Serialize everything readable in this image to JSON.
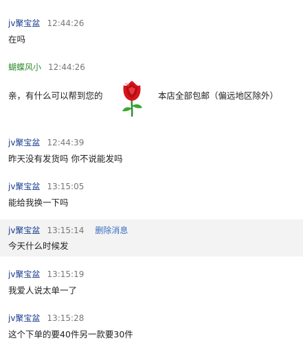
{
  "messages": [
    {
      "sender": "jv聚宝盆",
      "time": "12:44:26",
      "text": "在吗"
    },
    {
      "sender": "蝴蝶风小",
      "time": "12:44:26",
      "text_a": "亲，有什么可以帮到您的",
      "emoji": "rose-emoji",
      "text_b": "本店全部包邮（偏远地区除外）"
    },
    {
      "sender": "jv聚宝盆",
      "time": "12:44:39",
      "text": "昨天没有发货吗 你不说能发吗"
    },
    {
      "sender": "jv聚宝盆",
      "time": "13:15:05",
      "text": "能给我换一下吗"
    },
    {
      "sender": "jv聚宝盆",
      "time": "13:15:14",
      "action": "删除消息",
      "text": "今天什么时候发"
    },
    {
      "sender": "jv聚宝盆",
      "time": "13:15:19",
      "text": "我爱人说太单一了"
    },
    {
      "sender": "jv聚宝盆",
      "time": "13:15:28",
      "text": "这个下单的要40件另一款要30件"
    }
  ],
  "colors": {
    "customer_name": "#1a3d8f",
    "seller_name": "#2e8b2e",
    "timestamp": "#777777",
    "action_link": "#3b6fc2",
    "highlight_bg": "#f3f3f3"
  }
}
